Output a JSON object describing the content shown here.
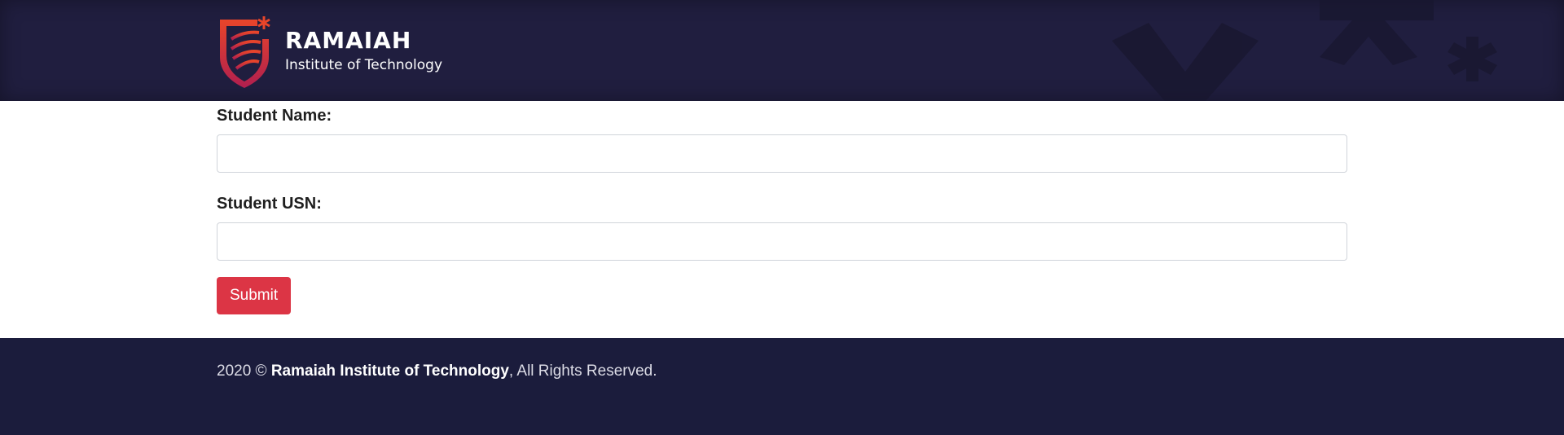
{
  "header": {
    "brand_name": "RAMAIAH",
    "brand_subtitle": "Institute of Technology",
    "logo_icon": "ramaiah-shield-logo",
    "background_color": "#201e3f"
  },
  "form": {
    "name_label": "Student Name:",
    "name_value": "",
    "usn_label": "Student USN:",
    "usn_value": "",
    "submit_label": "Submit",
    "submit_color": "#dc3545"
  },
  "footer": {
    "year": "2020 ©",
    "org_name": "Ramaiah Institute of Technology",
    "rights": ", All Rights Reserved.",
    "background_color": "#1b1c3c"
  }
}
